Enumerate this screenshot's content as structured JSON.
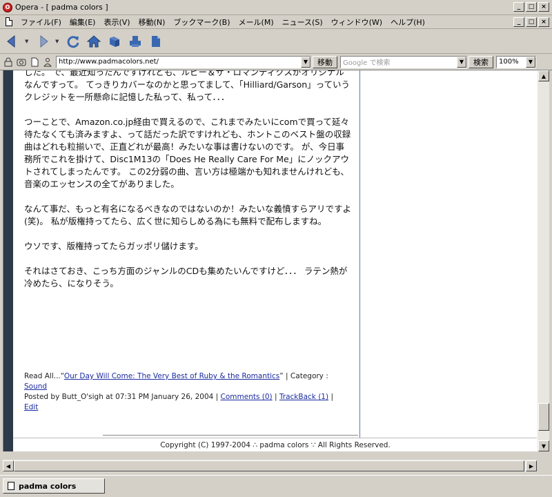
{
  "window": {
    "title": "Opera - [ padma colors ]",
    "min_glyph": "_",
    "max_glyph": "□",
    "close_glyph": "×"
  },
  "menu": {
    "items": [
      {
        "label": "ファイル(F)"
      },
      {
        "label": "編集(E)"
      },
      {
        "label": "表示(V)"
      },
      {
        "label": "移動(N)"
      },
      {
        "label": "ブックマーク(B)"
      },
      {
        "label": "メール(M)"
      },
      {
        "label": "ニュース(S)"
      },
      {
        "label": "ウィンドウ(W)"
      },
      {
        "label": "ヘルプ(H)"
      }
    ]
  },
  "toolbar": {
    "icons": [
      "back-icon",
      "forward-icon",
      "reload-icon",
      "home-icon",
      "hotlist-icon",
      "print-icon",
      "document-icon"
    ]
  },
  "address": {
    "url": "http://www.padmacolors.net/",
    "go_label": "移動",
    "search_placeholder": "Google で検索",
    "search_label": "検索",
    "zoom": "100%"
  },
  "article": {
    "paragraphs": [
      "した。 で、最近知ったんですけれども、ルビー＆ザ・ロマンティクスがオリジナルなんですって。 てっきりカバーなのかと思ってまして、「Hilliard/Garson」っていうクレジットを一所懸命に記憶した私って、私って．．．",
      "つーことで、Amazon.co.jp経由で買えるので、これまでみたいにcomで買って延々待たなくても済みますよ、って話だった訳ですけれども、ホントこのベスト盤の収録曲はどれも粒揃いで、正直どれが最高！みたいな事は書けないのです。 が、今日事務所でこれを掛けて、Disc1M13の「Does He Really Care For Me」にノックアウトされてしまったんです。 この2分弱の曲、言い方は極端かも知れませんけれども、音楽のエッセンスの全てがありました。",
      "なんて事だ、もっと有名になるべきなのではないのか！みたいな義憤すらアリですよ(笑)。 私が版権持ってたら、広く世に知らしめる為にも無料で配布しますね。",
      "ウソです、版権持ってたらガッポリ儲けます。",
      "それはさておき、こっち方面のジャンルのCDも集めたいんですけど．．． ラテン熱が冷めたら、になりそう。"
    ]
  },
  "meta": {
    "read_all_prefix": "Read All...“",
    "book_title": "Our Day Will Come: The Very Best of Ruby & the Romantics",
    "read_all_suffix": "” | Category :",
    "category": "Sound",
    "posted_by": "Posted by Butt_O'sigh at 07:31 PM January 26, 2004 |",
    "comments": "Comments (0)",
    "sep": "|",
    "trackback": "TrackBack (1)",
    "sep2": "|",
    "edit": "Edit"
  },
  "footer": {
    "text": "Copyright (C) 1997-2004 ∴ padma colors ∵ All Rights Reserved."
  },
  "tabs": [
    {
      "label": "padma colors"
    }
  ],
  "colors": {
    "page_bg": "#2c3a4a",
    "link": "#1a2aa0",
    "chrome": "#d4d0c8"
  },
  "scroll": {
    "vertical_position": 0.97,
    "horizontal_position": 0.0
  }
}
